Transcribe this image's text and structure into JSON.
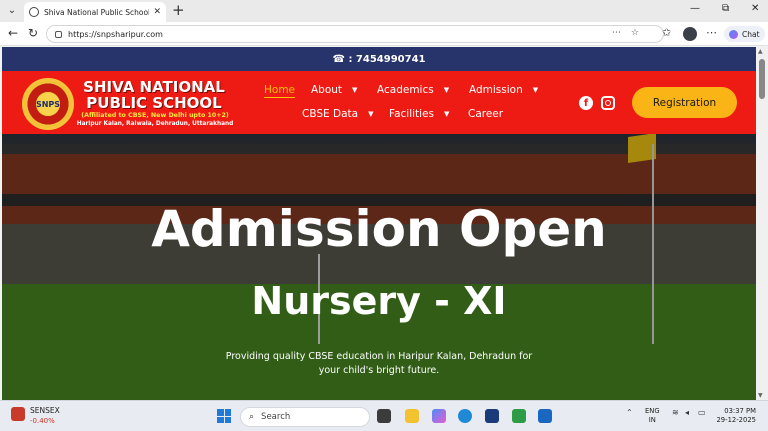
{
  "browser": {
    "tab_title": "Shiva National Public School - Exc",
    "url": "https://snpsharipur.com",
    "chat_label": "Chat"
  },
  "site": {
    "phone": "☎ : 7454990741",
    "school_name_line1": "SHIVA NATIONAL",
    "school_name_line2": "PUBLIC SCHOOL",
    "affiliation": "(Affiliated to CBSE, New Delhi upto 10+2)",
    "address": "Haripur Kalan, Raiwala, Dehradun, Uttarakhand",
    "logo_text": "SNPS",
    "nav": [
      {
        "label": "Home",
        "active": true
      },
      {
        "label": "About"
      },
      {
        "label": "Academics"
      },
      {
        "label": "Admission"
      },
      {
        "label": "CBSE Data"
      },
      {
        "label": "Facilities"
      },
      {
        "label": "Career"
      }
    ],
    "registration_label": "Registration",
    "hero": {
      "heading": "Admission Open",
      "subheading": "Nursery - XI",
      "text": "Providing quality CBSE education in Haripur Kalan, Dehradun for your child's bright future."
    },
    "colors": {
      "topbar": "#27346c",
      "header": "#ee1b14",
      "button": "#fbb416",
      "active_nav": "#ffc107"
    }
  },
  "taskbar": {
    "sensex_label": "SENSEX",
    "sensex_change": "-0.40%",
    "search_placeholder": "Search",
    "lang_line1": "ENG",
    "lang_line2": "IN",
    "time": "03:37 PM",
    "date": "29-12-2025"
  }
}
